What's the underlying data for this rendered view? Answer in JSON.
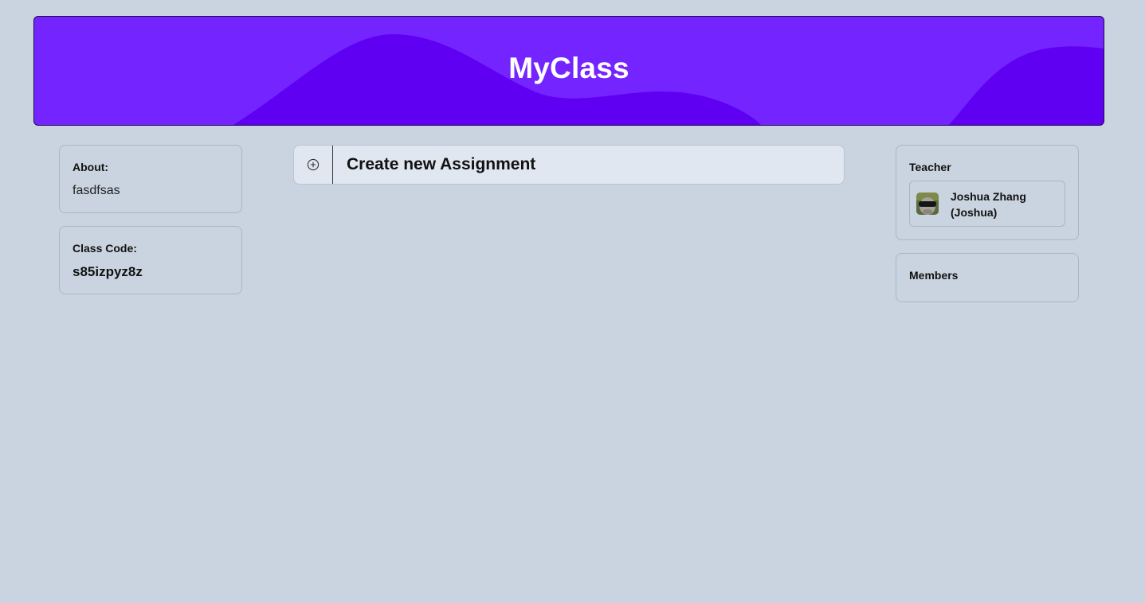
{
  "banner": {
    "title": "MyClass",
    "colors": {
      "background": "#7425ff",
      "wave": "#5f00f3"
    }
  },
  "about": {
    "label": "About:",
    "value": "fasdfsas"
  },
  "class_code": {
    "label": "Class Code:",
    "value": "s85izpyz8z"
  },
  "create_assignment": {
    "icon": "plus-circle-icon",
    "label": "Create new Assignment"
  },
  "teacher": {
    "label": "Teacher",
    "name": "Joshua Zhang (Joshua)",
    "avatar_icon": "avatar"
  },
  "members": {
    "label": "Members"
  }
}
